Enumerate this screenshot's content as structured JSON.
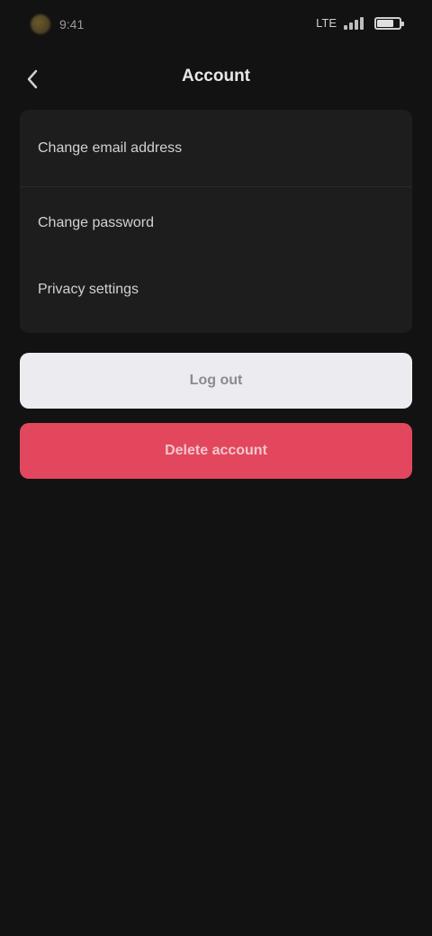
{
  "status_bar": {
    "time": "9:41",
    "network": "LTE"
  },
  "header": {
    "back_icon": "chevron-left-icon",
    "title": "Account"
  },
  "settings": {
    "items": [
      {
        "label": "Change email address"
      },
      {
        "label": "Change password"
      },
      {
        "label": "Privacy settings"
      }
    ]
  },
  "actions": {
    "primary_label": "Log out",
    "danger_label": "Delete account"
  },
  "colors": {
    "background": "#121212",
    "card": "#1d1d1d",
    "light_button": "#ecebef",
    "danger_button": "#e2475e"
  }
}
